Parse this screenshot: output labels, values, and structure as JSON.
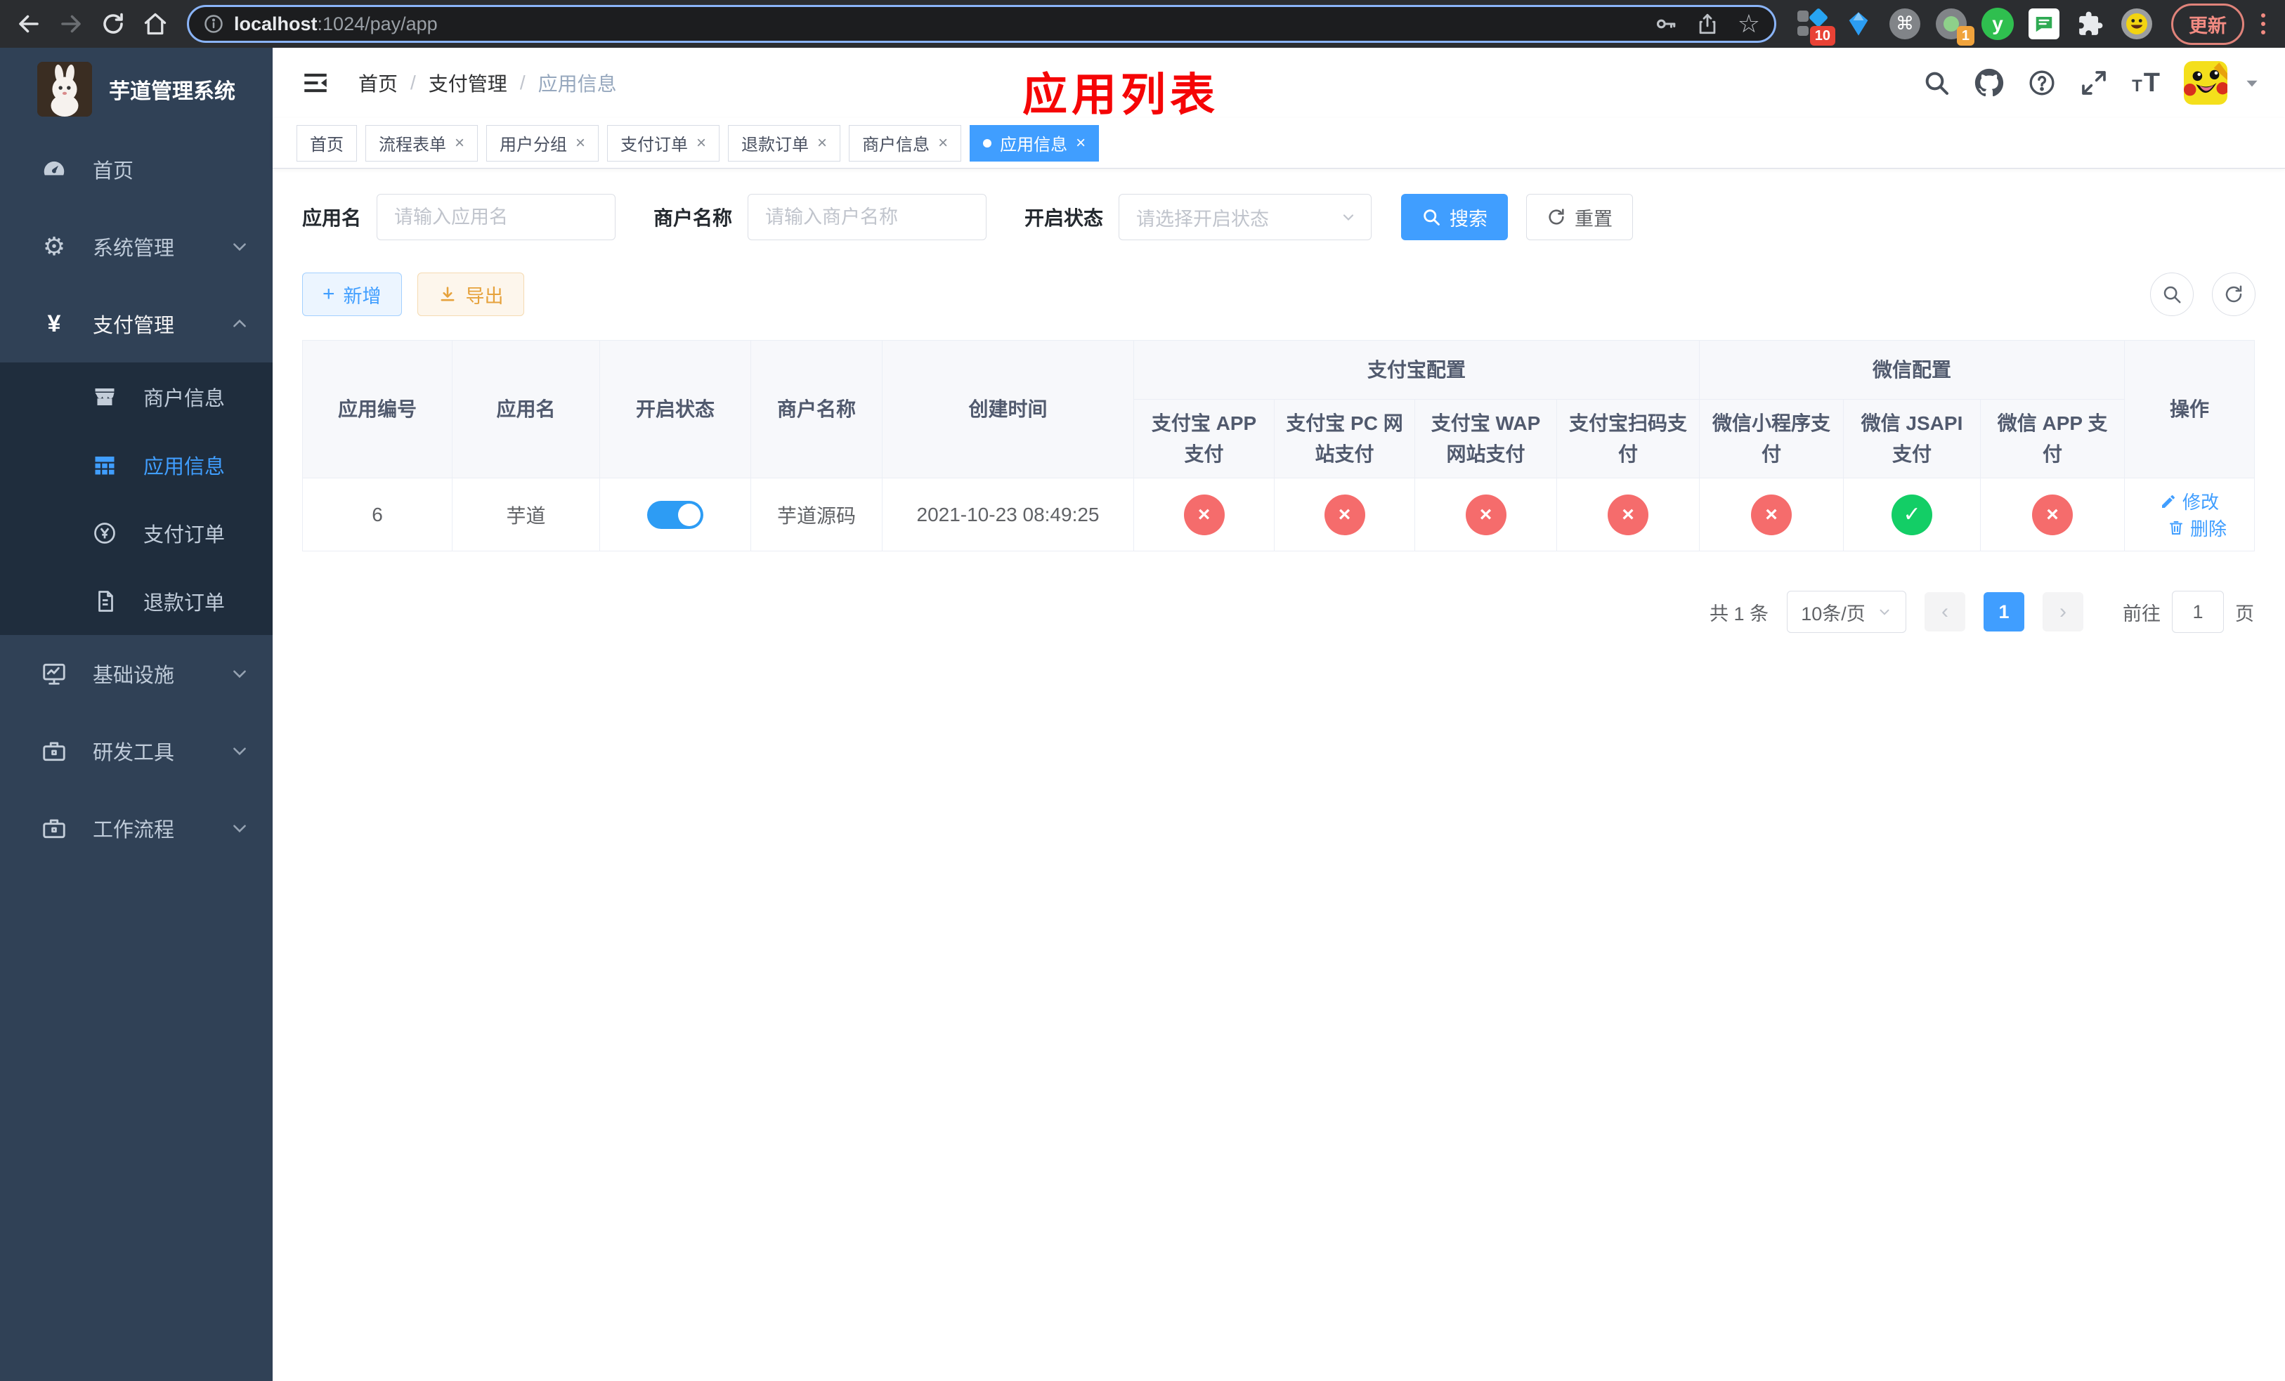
{
  "browser": {
    "url": {
      "host": "localhost",
      "path": ":1024/pay/app"
    },
    "update_label": "更新",
    "extension_badges": {
      "first": "10",
      "second": "1"
    },
    "command_glyph": "⌘",
    "y_glyph": "y",
    "star_glyph": "☆"
  },
  "sidebar": {
    "app_title": "芋道管理系统",
    "menu": [
      {
        "label": "首页"
      },
      {
        "label": "系统管理"
      },
      {
        "label": "支付管理"
      },
      {
        "label": "基础设施"
      },
      {
        "label": "研发工具"
      },
      {
        "label": "工作流程"
      }
    ],
    "submenu_pay": [
      {
        "label": "商户信息"
      },
      {
        "label": "应用信息"
      },
      {
        "label": "支付订单"
      },
      {
        "label": "退款订单"
      }
    ],
    "yen_glyph": "¥",
    "gear_glyph": "⚙"
  },
  "header": {
    "breadcrumb": [
      "首页",
      "支付管理",
      "应用信息"
    ],
    "separator": "/"
  },
  "annotation": {
    "page_title": "应用列表"
  },
  "tabs": [
    {
      "label": "首页"
    },
    {
      "label": "流程表单"
    },
    {
      "label": "用户分组"
    },
    {
      "label": "支付订单"
    },
    {
      "label": "退款订单"
    },
    {
      "label": "商户信息"
    },
    {
      "label": "应用信息"
    }
  ],
  "filters": {
    "app_name": {
      "label": "应用名",
      "placeholder": "请输入应用名",
      "value": ""
    },
    "merchant_name": {
      "label": "商户名称",
      "placeholder": "请输入商户名称",
      "value": ""
    },
    "status": {
      "label": "开启状态",
      "placeholder": "请选择开启状态"
    },
    "search_label": "搜索",
    "reset_label": "重置"
  },
  "toolbar": {
    "add_label": "新增",
    "export_label": "导出",
    "plus_glyph": "+"
  },
  "table": {
    "headers": {
      "id": "应用编号",
      "name": "应用名",
      "status": "开启状态",
      "merchant": "商户名称",
      "created": "创建时间",
      "alipay_group": "支付宝配置",
      "alipay": [
        "支付宝 APP 支付",
        "支付宝 PC 网站支付",
        "支付宝 WAP 网站支付",
        "支付宝扫码支付"
      ],
      "wechat_group": "微信配置",
      "wechat": [
        "微信小程序支付",
        "微信 JSAPI 支付",
        "微信 APP 支付"
      ],
      "actions": "操作"
    },
    "rows": [
      {
        "id": "6",
        "name": "芋道",
        "enabled": true,
        "merchant": "芋道源码",
        "created": "2021-10-23 08:49:25",
        "pay_channels": [
          "disabled",
          "disabled",
          "disabled",
          "disabled",
          "disabled",
          "enabled",
          "disabled"
        ],
        "edit_label": "修改",
        "delete_label": "删除"
      }
    ]
  },
  "pagination": {
    "total_text": "共 1 条",
    "page_size_text": "10条/页",
    "current_page": "1",
    "goto_prefix": "前往",
    "goto_value": "1",
    "goto_suffix": "页"
  },
  "icons_text": {
    "close": "×",
    "prev": "‹",
    "next": "›",
    "check": "✓",
    "cross": "×"
  }
}
